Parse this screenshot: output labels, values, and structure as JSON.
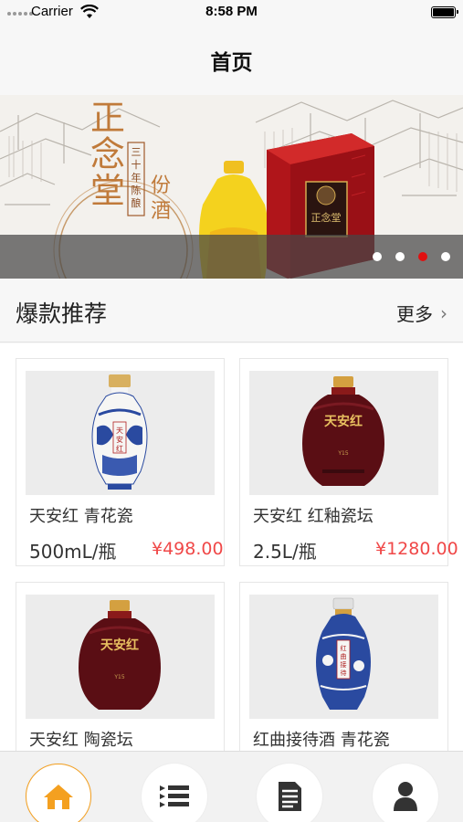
{
  "status_bar": {
    "carrier": "Carrier",
    "time": "8:58 PM"
  },
  "nav": {
    "title": "首页"
  },
  "banner": {
    "brand_text": "正念堂",
    "vertical_text": "三十年陈酿",
    "side_text": "份酒",
    "box_text": "正念堂",
    "dot_count": 4,
    "active_dot_index": 2
  },
  "section": {
    "title": "爆款推荐",
    "more_label": "更多",
    "more_icon": "chevron-right-icon"
  },
  "products": [
    {
      "name": "天安红 青花瓷",
      "spec": "500mL/瓶",
      "price": "¥498.00",
      "bottle_style": "blue-white-porcelain",
      "bottle_label": "天安红"
    },
    {
      "name": "天安红 红釉瓷坛",
      "spec": "2.5L/瓶",
      "price": "¥1280.00",
      "bottle_style": "red-glaze-jar",
      "bottle_label": "天安红"
    },
    {
      "name": "天安红 陶瓷坛",
      "spec": "",
      "price": "",
      "bottle_style": "red-glaze-jar",
      "bottle_label": "天安红"
    },
    {
      "name": "红曲接待酒 青花瓷",
      "spec": "",
      "price": "",
      "bottle_style": "blue-white-porcelain",
      "bottle_label": "红曲接待"
    }
  ],
  "tab_bar": {
    "tabs": [
      {
        "icon": "home-icon",
        "active": true
      },
      {
        "icon": "list-icon",
        "active": false
      },
      {
        "icon": "document-icon",
        "active": false
      },
      {
        "icon": "user-icon",
        "active": false
      }
    ]
  },
  "colors": {
    "accent": "#f4a020",
    "price": "#f04848",
    "active_dot": "#e01010"
  }
}
